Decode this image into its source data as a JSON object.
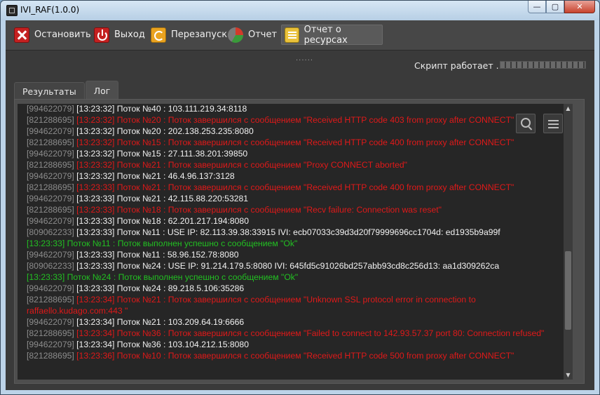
{
  "window": {
    "title": "IVI_RAF(1.0.0)",
    "min_glyph": "—",
    "max_glyph": "▢",
    "close_glyph": "✕"
  },
  "toolbar": {
    "stop_label": "Остановить",
    "exit_label": "Выход",
    "restart_label": "Перезапуск",
    "report_label": "Отчет",
    "resource_label": "Отчет о ресурсах"
  },
  "splitter": {
    "dots": "......"
  },
  "status": {
    "text": "Скрипт работает ...",
    "progress_percent": 100
  },
  "tabs": [
    {
      "label": "Результаты",
      "active": false
    },
    {
      "label": "Лог",
      "active": true
    }
  ],
  "log": [
    {
      "pid": "[994622079]",
      "text": " [13:23:32] Поток №40 : 103.111.219.34:8118",
      "type": "info"
    },
    {
      "pid": "[821288695]",
      "text": " [13:23:32] Поток №20 : Поток завершился с сообщением \"Received HTTP code 403 from proxy after CONNECT\"",
      "type": "err"
    },
    {
      "pid": "[994622079]",
      "text": " [13:23:32] Поток №20 : 202.138.253.235:8080",
      "type": "info"
    },
    {
      "pid": "[821288695]",
      "text": " [13:23:32] Поток №15 : Поток завершился с сообщением \"Received HTTP code 400 from proxy after CONNECT\"",
      "type": "err"
    },
    {
      "pid": "[994622079]",
      "text": " [13:23:32] Поток №15 : 27.111.38.201:39850",
      "type": "info"
    },
    {
      "pid": "[821288695]",
      "text": " [13:23:32] Поток №21 : Поток завершился с сообщением \"Proxy CONNECT aborted\"",
      "type": "err"
    },
    {
      "pid": "[994622079]",
      "text": " [13:23:32] Поток №21 : 46.4.96.137:3128",
      "type": "info"
    },
    {
      "pid": "[821288695]",
      "text": " [13:23:33] Поток №21 : Поток завершился с сообщением \"Received HTTP code 400 from proxy after CONNECT\"",
      "type": "err"
    },
    {
      "pid": "[994622079]",
      "text": " [13:23:33] Поток №21 : 42.115.88.220:53281",
      "type": "info"
    },
    {
      "pid": "[821288695]",
      "text": " [13:23:33] Поток №18 : Поток завершился с сообщением \"Recv failure: Connection was reset\"",
      "type": "err"
    },
    {
      "pid": "[994622079]",
      "text": " [13:23:33] Поток №18 : 62.201.217.194:8080",
      "type": "info"
    },
    {
      "pid": "[809062233]",
      "text": " [13:23:33] Поток №11 : USE IP: 82.113.39.38:33915 IVI: ecb07033c39d3d20f79999696cc1704d: ed1935b9a99f",
      "type": "info"
    },
    {
      "pid": "",
      "text": "[13:23:33] Поток №11 : Поток выполнен успешно с сообщением \"Ok\"",
      "type": "ok"
    },
    {
      "pid": "[994622079]",
      "text": " [13:23:33] Поток №11 : 58.96.152.78:8080",
      "type": "info"
    },
    {
      "pid": "[809062233]",
      "text": " [13:23:33] Поток №24 : USE IP: 91.214.179.5:8080 IVI: 645fd5c91026bd257abb93cd8c256d13: aa1d309262ca",
      "type": "info"
    },
    {
      "pid": "",
      "text": "[13:23:33] Поток №24 : Поток выполнен успешно с сообщением \"Ok\"",
      "type": "ok"
    },
    {
      "pid": "[994622079]",
      "text": " [13:23:33] Поток №24 : 89.218.5.106:35286",
      "type": "info"
    },
    {
      "pid": "[821288695]",
      "text": " [13:23:34] Поток №21 : Поток завершился с сообщением \"Unknown SSL protocol error in connection to raffaello.kudago.com:443 \"",
      "type": "err"
    },
    {
      "pid": "[994622079]",
      "text": " [13:23:34] Поток №21 : 103.209.64.19:6666",
      "type": "info"
    },
    {
      "pid": "[821288695]",
      "text": " [13:23:34] Поток №36 : Поток завершился с сообщением \"Failed to connect to 142.93.57.37 port 80: Connection refused\"",
      "type": "err"
    },
    {
      "pid": "[994622079]",
      "text": " [13:23:34] Поток №36 : 103.104.212.15:8080",
      "type": "info"
    },
    {
      "pid": "[821288695]",
      "text": " [13:23:36] Поток №10 : Поток завершился с сообщением \"Received HTTP code 500 from proxy after CONNECT\"",
      "type": "err"
    }
  ],
  "scrollbar": {
    "up_glyph": "▲",
    "down_glyph": "▼"
  },
  "icons": {
    "stop": "stop-icon",
    "exit": "power-icon",
    "restart": "restart-icon",
    "report": "pie-chart-icon",
    "resource": "list-icon",
    "search": "search-icon",
    "menu": "hamburger-menu-icon"
  },
  "colors": {
    "error": "#e01919",
    "success": "#22c022",
    "info": "#f2f2f2",
    "pid": "#8c8c8c"
  }
}
